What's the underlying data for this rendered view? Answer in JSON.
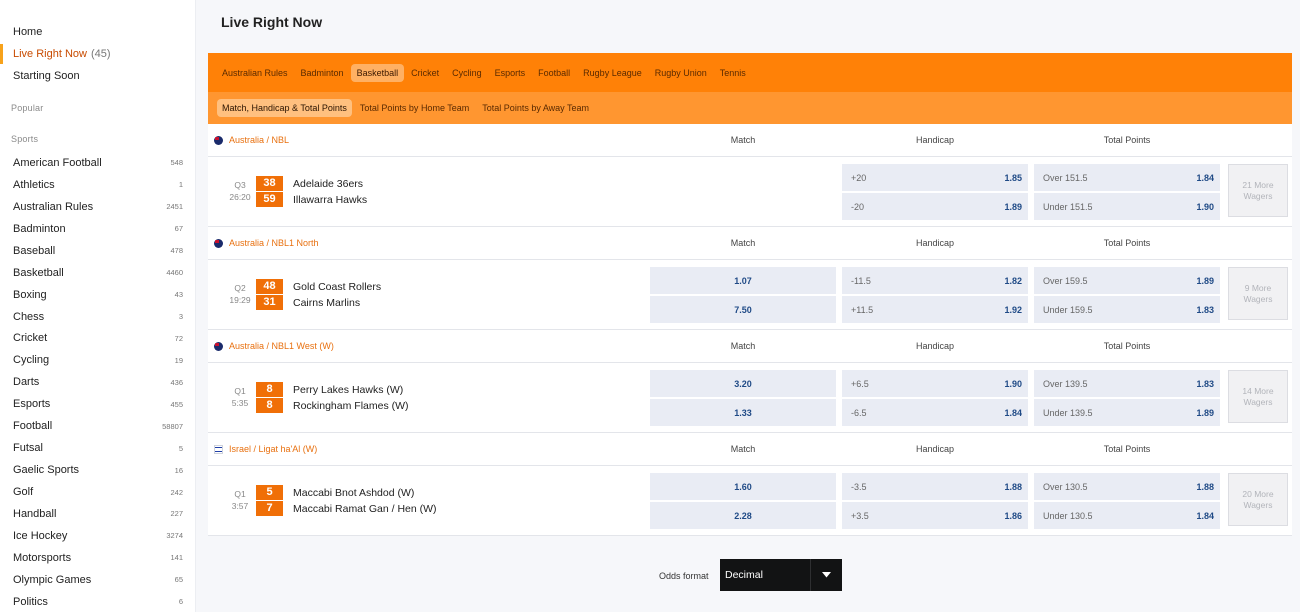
{
  "sidebar": {
    "home": "Home",
    "live": "Live Right Now",
    "live_count": "(45)",
    "starting_soon": "Starting Soon",
    "popular_label": "Popular",
    "sports_label": "Sports",
    "sports": [
      {
        "name": "American Football",
        "count": "548"
      },
      {
        "name": "Athletics",
        "count": "1"
      },
      {
        "name": "Australian Rules",
        "count": "2451"
      },
      {
        "name": "Badminton",
        "count": "67"
      },
      {
        "name": "Baseball",
        "count": "478"
      },
      {
        "name": "Basketball",
        "count": "4460"
      },
      {
        "name": "Boxing",
        "count": "43"
      },
      {
        "name": "Chess",
        "count": "3"
      },
      {
        "name": "Cricket",
        "count": "72"
      },
      {
        "name": "Cycling",
        "count": "19"
      },
      {
        "name": "Darts",
        "count": "436"
      },
      {
        "name": "Esports",
        "count": "455"
      },
      {
        "name": "Football",
        "count": "58807"
      },
      {
        "name": "Futsal",
        "count": "5"
      },
      {
        "name": "Gaelic Sports",
        "count": "16"
      },
      {
        "name": "Golf",
        "count": "242"
      },
      {
        "name": "Handball",
        "count": "227"
      },
      {
        "name": "Ice Hockey",
        "count": "3274"
      },
      {
        "name": "Motorsports",
        "count": "141"
      },
      {
        "name": "Olympic Games",
        "count": "65"
      },
      {
        "name": "Politics",
        "count": "6"
      }
    ]
  },
  "page": {
    "title": "Live Right Now"
  },
  "sport_tabs": [
    "Australian Rules",
    "Badminton",
    "Basketball",
    "Cricket",
    "Cycling",
    "Esports",
    "Football",
    "Rugby League",
    "Rugby Union",
    "Tennis"
  ],
  "market_tabs": [
    "Match, Handicap & Total Points",
    "Total Points by Home Team",
    "Total Points by Away Team"
  ],
  "columns": {
    "match": "Match",
    "handicap": "Handicap",
    "total": "Total Points"
  },
  "events": [
    {
      "league": "Australia / NBL",
      "period": "Q3",
      "time": "26:20",
      "home": {
        "team": "Adelaide 36ers",
        "score": "38"
      },
      "away": {
        "team": "Illawarra Hawks",
        "score": "59"
      },
      "match": null,
      "handicap": [
        {
          "line": "+20",
          "odds": "1.85"
        },
        {
          "line": "-20",
          "odds": "1.89"
        }
      ],
      "total": [
        {
          "line": "Over 151.5",
          "odds": "1.84"
        },
        {
          "line": "Under 151.5",
          "odds": "1.90"
        }
      ],
      "more": "21 More Wagers"
    },
    {
      "league": "Australia / NBL1 North",
      "period": "Q2",
      "time": "19:29",
      "home": {
        "team": "Gold Coast Rollers",
        "score": "48"
      },
      "away": {
        "team": "Cairns Marlins",
        "score": "31"
      },
      "match": [
        "1.07",
        "7.50"
      ],
      "handicap": [
        {
          "line": "-11.5",
          "odds": "1.82"
        },
        {
          "line": "+11.5",
          "odds": "1.92"
        }
      ],
      "total": [
        {
          "line": "Over 159.5",
          "odds": "1.89"
        },
        {
          "line": "Under 159.5",
          "odds": "1.83"
        }
      ],
      "more": "9 More Wagers"
    },
    {
      "league": "Australia / NBL1 West (W)",
      "period": "Q1",
      "time": "5:35",
      "home": {
        "team": "Perry Lakes Hawks (W)",
        "score": "8"
      },
      "away": {
        "team": "Rockingham Flames (W)",
        "score": "8"
      },
      "match": [
        "3.20",
        "1.33"
      ],
      "handicap": [
        {
          "line": "+6.5",
          "odds": "1.90"
        },
        {
          "line": "-6.5",
          "odds": "1.84"
        }
      ],
      "total": [
        {
          "line": "Over 139.5",
          "odds": "1.83"
        },
        {
          "line": "Under 139.5",
          "odds": "1.89"
        }
      ],
      "more": "14 More Wagers"
    },
    {
      "league": "Israel / Ligat ha'Al (W)",
      "period": "Q1",
      "time": "3:57",
      "home": {
        "team": "Maccabi Bnot Ashdod (W)",
        "score": "5"
      },
      "away": {
        "team": "Maccabi Ramat Gan / Hen (W)",
        "score": "7"
      },
      "match": [
        "1.60",
        "2.28"
      ],
      "handicap": [
        {
          "line": "-3.5",
          "odds": "1.88"
        },
        {
          "line": "+3.5",
          "odds": "1.86"
        }
      ],
      "total": [
        {
          "line": "Over 130.5",
          "odds": "1.88"
        },
        {
          "line": "Under 130.5",
          "odds": "1.84"
        }
      ],
      "more": "20 More Wagers"
    }
  ],
  "odds_format": {
    "label": "Odds format",
    "value": "Decimal"
  }
}
